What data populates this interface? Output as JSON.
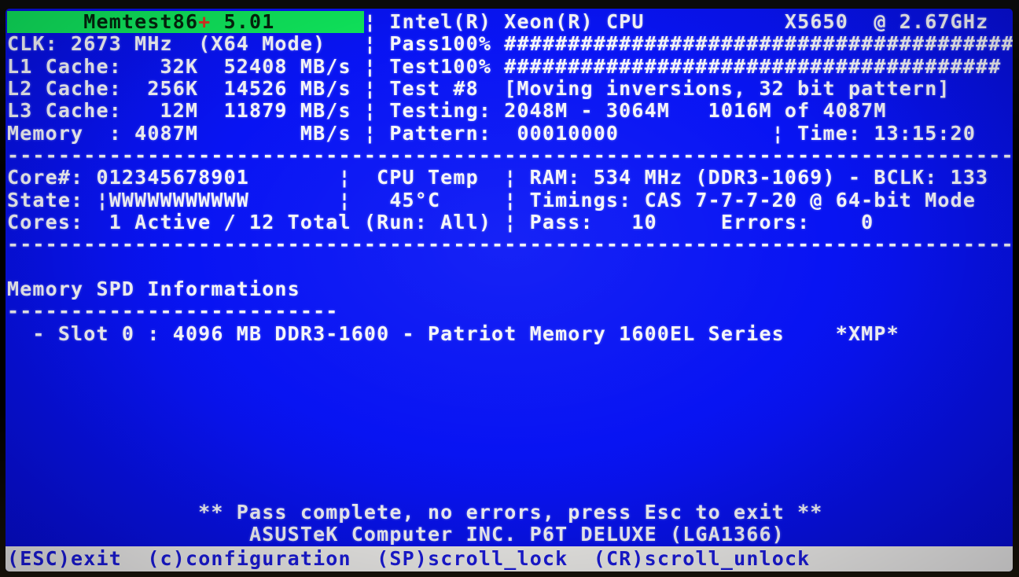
{
  "app": {
    "title": "Memtest86+",
    "version": "5.01"
  },
  "colors": {
    "screen_blue": "#0813f2",
    "header_green": "#0fe45a",
    "header_text": "#05230c",
    "plus_red": "#de3222",
    "text_white": "#f5f5f9",
    "statusbar_bg": "#edece8",
    "statusbar_text": "#1b1bd8"
  },
  "status": {
    "cpu_model": "Intel(R) Xeon(R) CPU X5650 @ 2.67GHz",
    "pass_percent": "100%",
    "test_percent": "100%",
    "current_test": "Test #8  [Moving inversions, 32 bit pattern]",
    "testing_range": "2048M - 3064M   1016M of 4087M",
    "pattern": "00010000",
    "time": "13:15:20",
    "cpu_temp": "45°C",
    "ram": "534 MHz (DDR3-1069) - BCLK: 133",
    "timings": "CAS 7-7-7-20 @ 64-bit Mode",
    "pass_count": "10",
    "error_count": "0",
    "slot0": "4096 MB DDR3-1600 - Patriot Memory 1600EL Series",
    "xmp": "*XMP*",
    "motherboard": "ASUSTeK Computer INC. P6T DELUXE (LGA1366)",
    "message": "** Pass complete, no errors, press Esc to exit **"
  },
  "screen": {
    "rows": [
      {
        "name": "header-row",
        "segs": [
          {
            "t": "      Memtest86",
            "c": "g",
            "n": "memtest-title"
          },
          {
            "t": "+",
            "c": "gp",
            "n": "memtest-title-plus"
          },
          {
            "t": " 5.01       ",
            "c": "g",
            "n": "memtest-version"
          },
          {
            "t": "¦ Intel(R) Xeon(R) CPU           X5650  @ 2.67GHz",
            "n": "cpu-model"
          }
        ]
      },
      {
        "name": "clk-and-pass-progress",
        "segs": [
          {
            "t": "CLK: 2673 MHz  (X64 Mode)   ¦ Pass100% ########################################",
            "n": "clk-pass-line"
          }
        ]
      },
      {
        "name": "l1-cache-and-test-progress",
        "segs": [
          {
            "t": "L1 Cache:   32K  52408 MB/s ¦ Test100% #######################################",
            "n": "l1-test-line"
          }
        ]
      },
      {
        "name": "l2-cache-and-test-name",
        "segs": [
          {
            "t": "L2 Cache:  256K  14526 MB/s ¦ Test #8  [Moving inversions, 32 bit pattern]",
            "n": "l2-testname-line"
          }
        ]
      },
      {
        "name": "l3-cache-and-testing-range",
        "segs": [
          {
            "t": "L3 Cache:   12M  11879 MB/s ¦ Testing: 2048M - 3064M   1016M of 4087M",
            "n": "l3-testing-line"
          }
        ]
      },
      {
        "name": "memory-and-pattern-time",
        "segs": [
          {
            "t": "Memory  : 4087M        MB/s ¦ Pattern:  00010000            ¦ Time: 13:15:20",
            "n": "memory-pattern-time-line"
          }
        ]
      },
      {
        "name": "separator-line",
        "segs": [
          {
            "t": "--------------------------------------------------------------------------------",
            "n": "dashed-separator"
          }
        ]
      },
      {
        "name": "core-map-cpu-temp-ram",
        "segs": [
          {
            "t": "Core#: 012345678901       ¦  CPU Temp  ¦ RAM: 534 MHz (DDR3-1069) - BCLK: 133",
            "n": "core-temp-ram-line"
          }
        ]
      },
      {
        "name": "core-state-temp-timings",
        "segs": [
          {
            "t": "State: ¦WWWWWWWWWWW       ¦   45°C     ¦ Timings: CAS 7-7-7-20 @ 64-bit Mode",
            "n": "state-temp-timings-line"
          }
        ]
      },
      {
        "name": "cores-active-pass-errors",
        "segs": [
          {
            "t": "Cores:  1 Active / 12 Total (Run: All) ¦ Pass:   10     Errors:    0",
            "n": "cores-pass-errors-line"
          }
        ]
      },
      {
        "name": "separator-line",
        "segs": [
          {
            "t": "--------------------------------------------------------------------------------",
            "n": "dashed-separator"
          }
        ]
      },
      {
        "name": "blank-row",
        "segs": [
          {
            "t": "",
            "n": "blank"
          }
        ]
      },
      {
        "name": "spd-heading",
        "segs": [
          {
            "t": "Memory SPD Informations",
            "n": "spd-heading-text"
          }
        ]
      },
      {
        "name": "spd-underline",
        "segs": [
          {
            "t": "--------------------------",
            "n": "dashed-underline"
          }
        ]
      },
      {
        "name": "spd-slot0",
        "segs": [
          {
            "t": "  - Slot 0 : 4096 MB DDR3-1600 - Patriot Memory 1600EL Series    *XMP*",
            "n": "slot0-info"
          }
        ]
      },
      {
        "name": "blank-row",
        "segs": [
          {
            "t": "",
            "n": "blank"
          }
        ]
      },
      {
        "name": "blank-row",
        "segs": [
          {
            "t": "",
            "n": "blank"
          }
        ]
      },
      {
        "name": "blank-row",
        "segs": [
          {
            "t": "",
            "n": "blank"
          }
        ]
      },
      {
        "name": "blank-row",
        "segs": [
          {
            "t": "",
            "n": "blank"
          }
        ]
      },
      {
        "name": "blank-row",
        "segs": [
          {
            "t": "",
            "n": "blank"
          }
        ]
      },
      {
        "name": "blank-row",
        "segs": [
          {
            "t": "",
            "n": "blank"
          }
        ]
      },
      {
        "name": "blank-row",
        "segs": [
          {
            "t": "",
            "n": "blank"
          }
        ]
      },
      {
        "name": "pass-complete-message",
        "segs": [
          {
            "t": "               ** Pass complete, no errors, press Esc to exit **",
            "n": "pass-complete-text"
          }
        ]
      },
      {
        "name": "motherboard-info",
        "segs": [
          {
            "t": "                   ASUSTeK Computer INC. P6T DELUXE (LGA1366)",
            "n": "motherboard-text"
          }
        ]
      }
    ]
  },
  "status_bar": {
    "separator": "  ",
    "items": [
      {
        "name": "key-hint-esc-exit",
        "label": "(ESC)exit"
      },
      {
        "name": "key-hint-c-configuration",
        "label": "(c)configuration"
      },
      {
        "name": "key-hint-sp-scroll-lock",
        "label": "(SP)scroll_lock"
      },
      {
        "name": "key-hint-cr-scroll-unlock",
        "label": "(CR)scroll_unlock"
      }
    ]
  }
}
